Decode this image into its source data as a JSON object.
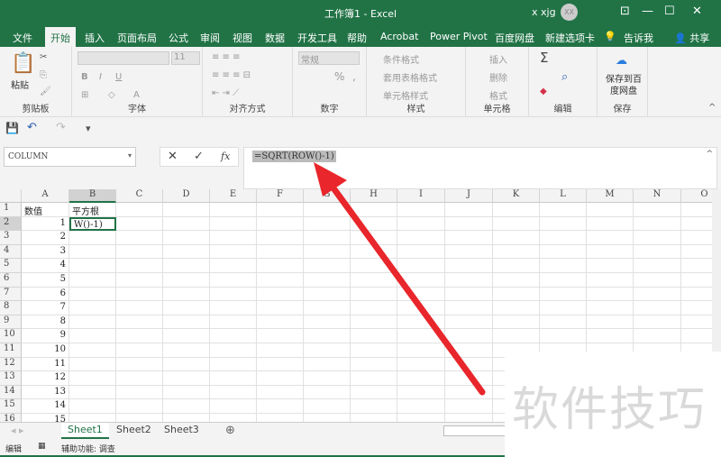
{
  "window": {
    "title": "工作簿1 - Excel",
    "user": "x xjg",
    "avatar": "XX"
  },
  "ribbon_tabs": [
    "文件",
    "开始",
    "插入",
    "页面布局",
    "公式",
    "审阅",
    "视图",
    "数据",
    "开发工具",
    "帮助",
    "Acrobat",
    "Power Pivot",
    "百度网盘",
    "新建选项卡",
    "告诉我",
    "共享"
  ],
  "ribbon": {
    "clipboard": {
      "paste": "粘贴",
      "label": "剪贴板"
    },
    "font": {
      "size": "11",
      "label": "字体",
      "bold": "B",
      "italic": "I",
      "underline": "U"
    },
    "alignment": {
      "label": "对齐方式"
    },
    "number": {
      "format": "常规",
      "percent": "%",
      "comma": ",",
      "label": "数字"
    },
    "styles": {
      "conditional": "条件格式",
      "table": "套用表格格式",
      "cell": "单元格样式",
      "label": "样式"
    },
    "cells": {
      "insert": "插入",
      "delete": "删除",
      "format": "格式",
      "label": "单元格"
    },
    "editing": {
      "sum": "Σ",
      "label": "编辑"
    },
    "save": {
      "button": "保存到百度网盘",
      "label": "保存"
    }
  },
  "formula_bar": {
    "name_box": "COLUMN",
    "formula": "=SQRT(ROW()-1)",
    "fx": "fx"
  },
  "columns": [
    "A",
    "B",
    "C",
    "D",
    "E",
    "F",
    "G",
    "H",
    "I",
    "J",
    "K",
    "L",
    "M",
    "N",
    "O"
  ],
  "rows": [
    [
      "数值",
      "平方根"
    ],
    [
      "1",
      "W()-1)"
    ],
    [
      "2",
      ""
    ],
    [
      "3",
      ""
    ],
    [
      "4",
      ""
    ],
    [
      "5",
      ""
    ],
    [
      "6",
      ""
    ],
    [
      "7",
      ""
    ],
    [
      "8",
      ""
    ],
    [
      "9",
      ""
    ],
    [
      "10",
      ""
    ],
    [
      "11",
      ""
    ],
    [
      "12",
      ""
    ],
    [
      "13",
      ""
    ],
    [
      "14",
      ""
    ],
    [
      "15",
      ""
    ]
  ],
  "sheet_tabs": [
    "Sheet1",
    "Sheet2",
    "Sheet3"
  ],
  "active_sheet": "Sheet1",
  "status": {
    "mode": "编辑",
    "accessibility": "辅助功能: 调查"
  },
  "watermark": "软件技巧",
  "colors": {
    "accent": "#217346",
    "arrow": "#e8262b"
  }
}
